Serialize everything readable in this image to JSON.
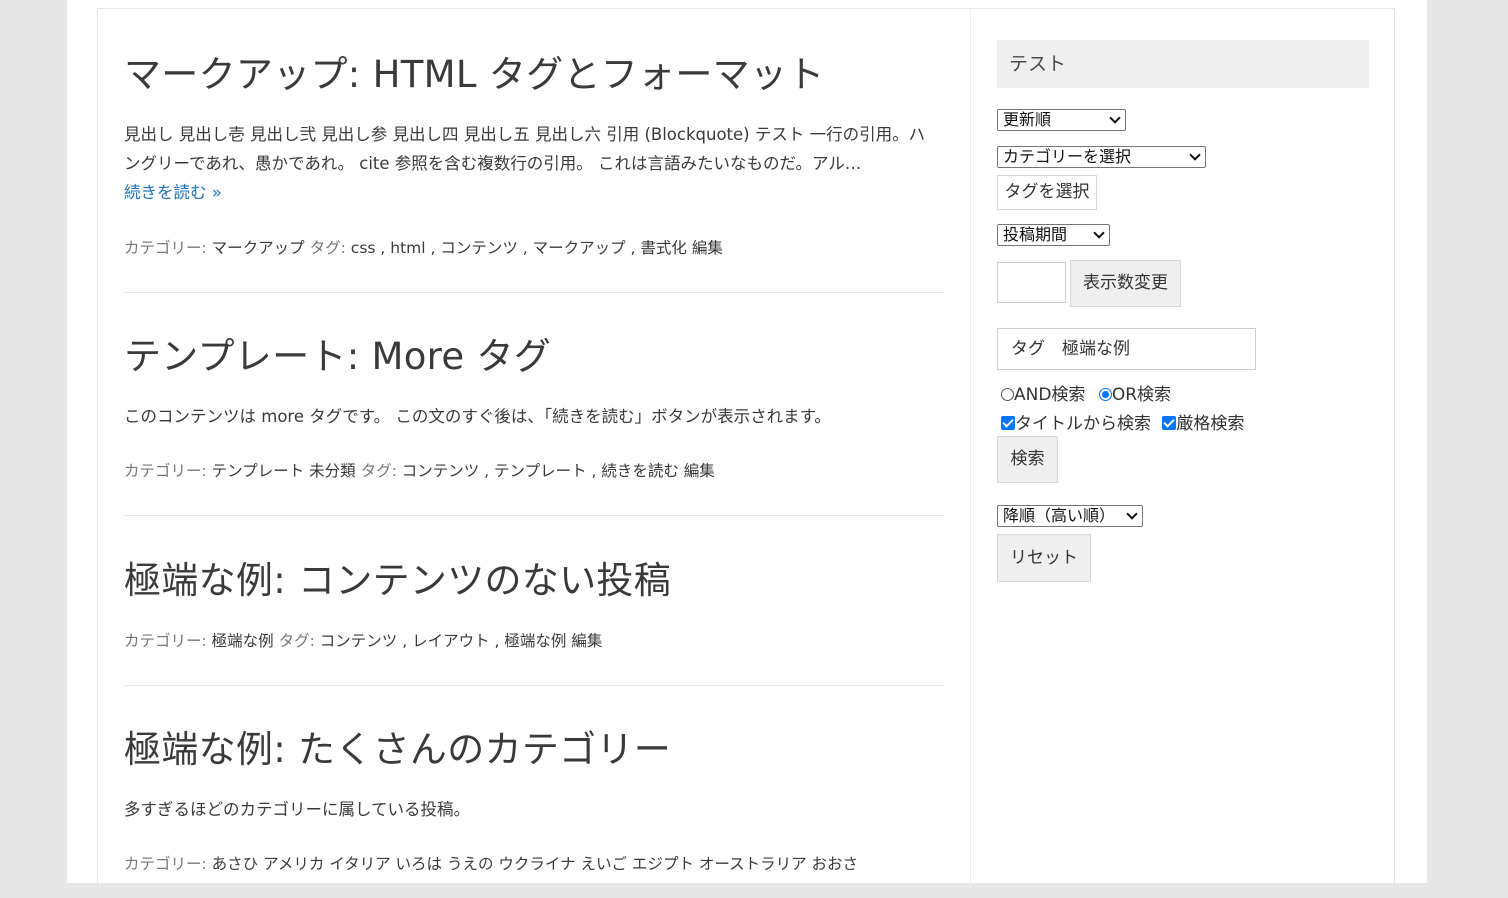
{
  "posts": [
    {
      "title": "マークアップ: HTML タグとフォーマット",
      "excerpt": "見出し 見出し壱 見出し弐 見出し参 見出し四 見出し五 見出し六 引用 (Blockquote) テスト 一行の引用。ハングリーであれ、愚かであれ。 cite 参照を含む複数行の引用。 これは言語みたいなものだ。アル…",
      "read_more": "続きを読む »",
      "cat_label": "カテゴリー:",
      "categories": "マークアップ",
      "tag_label": "タグ:",
      "tags": "css , html , コンテンツ , マークアップ , 書式化",
      "edit": "編集"
    },
    {
      "title": "テンプレート: More タグ",
      "excerpt": "このコンテンツは more タグです。 この文のすぐ後は、「続きを読む」ボタンが表示されます。",
      "cat_label": "カテゴリー:",
      "categories": "テンプレート  未分類",
      "tag_label": "タグ:",
      "tags": "コンテンツ , テンプレート , 続きを読む",
      "edit": "編集"
    },
    {
      "title": "極端な例: コンテンツのない投稿",
      "cat_label": "カテゴリー:",
      "categories": "極端な例",
      "tag_label": "タグ:",
      "tags": "コンテンツ , レイアウト , 極端な例",
      "edit": "編集"
    },
    {
      "title": "極端な例: たくさんのカテゴリー",
      "excerpt": "多すぎるほどのカテゴリーに属している投稿。",
      "cat_label": "カテゴリー:",
      "categories": "あさひ  アメリカ  イタリア  いろは  うえの  ウクライナ  えいご  エジプト  オーストラリア  おおさ"
    }
  ],
  "sidebar": {
    "widget_title": "テスト",
    "sort_select": "更新順",
    "category_select": "カテゴリーを選択",
    "tag_button": "タグを選択",
    "period_select": "投稿期間",
    "count_input": "",
    "count_button": "表示数変更",
    "search_input": "タグ　極端な例",
    "and_label": "AND検索",
    "or_label": "OR検索",
    "title_search_label": "タイトルから検索",
    "strict_search_label": "厳格検索",
    "search_button": "検索",
    "order_select": "降順（高い順）",
    "reset_button": "リセット"
  }
}
